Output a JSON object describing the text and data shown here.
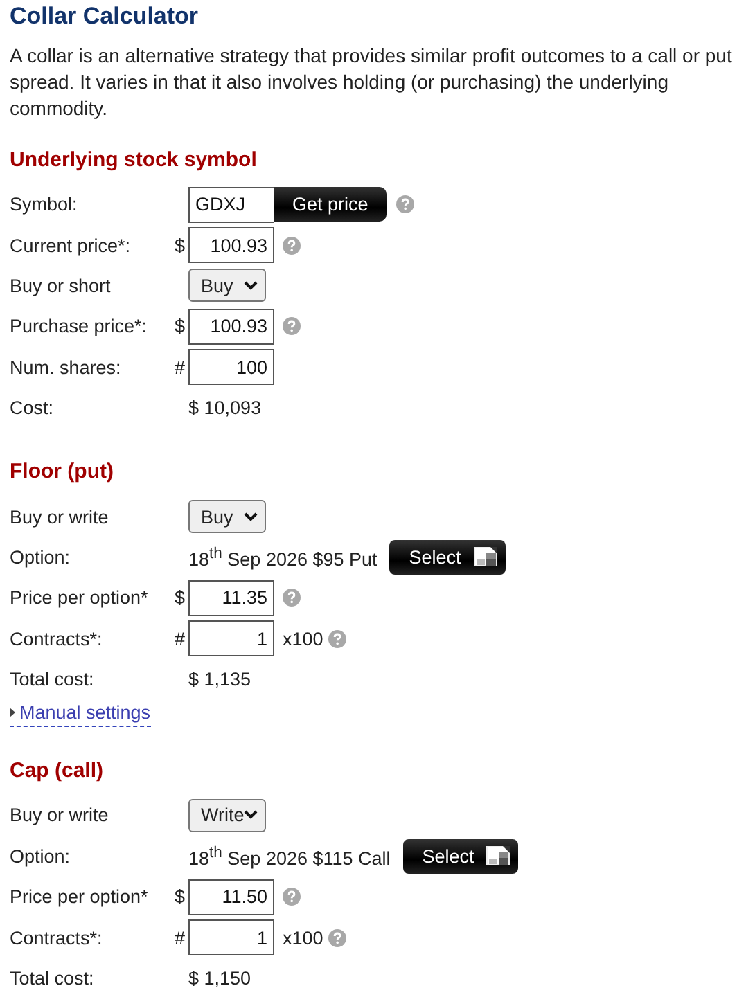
{
  "title": "Collar Calculator",
  "intro": "A collar is an alternative strategy that provides similar profit outcomes to a call or put spread. It varies in that it also involves holding (or purchasing) the underlying commodity.",
  "sections": [
    {
      "heading": "Underlying stock symbol",
      "rows": [
        {
          "kind": "symbol",
          "label": "Symbol:",
          "value": "GDXJ",
          "button": "Get price",
          "help": true
        },
        {
          "kind": "input",
          "label": "Current price*:",
          "prefix": "$",
          "value": "100.93",
          "help": true
        },
        {
          "kind": "select",
          "label": "Buy or short",
          "value": "Buy"
        },
        {
          "kind": "input",
          "label": "Purchase price*:",
          "prefix": "$",
          "value": "100.93",
          "help": true
        },
        {
          "kind": "input",
          "label": "Num. shares:",
          "prefix": "#",
          "value": "100",
          "help": false
        },
        {
          "kind": "text",
          "label": "Cost:",
          "value": "$ 10,093"
        }
      ]
    },
    {
      "heading": "Floor (put)",
      "rows": [
        {
          "kind": "select",
          "label": "Buy or write",
          "value": "Buy"
        },
        {
          "kind": "option",
          "label": "Option:",
          "value": "18$^{th}$ Sep 2026 $95 Put",
          "button": "Select"
        },
        {
          "kind": "input",
          "label": "Price per option*",
          "prefix": "$",
          "value": "11.35",
          "help": true
        },
        {
          "kind": "input",
          "label": "Contracts*:",
          "prefix": "#",
          "value": "1",
          "suffix": "x100",
          "help": true
        },
        {
          "kind": "text",
          "label": "Total cost:",
          "value": "$ 1,135"
        }
      ],
      "expander": {
        "label": "Manual settings",
        "expanded": false
      }
    },
    {
      "heading": "Cap (call)",
      "rows": [
        {
          "kind": "select",
          "label": "Buy or write",
          "value": "Write"
        },
        {
          "kind": "option",
          "label": "Option:",
          "value": "18$^{th}$ Sep 2026 $115 Call",
          "button": "Select"
        },
        {
          "kind": "input",
          "label": "Price per option*",
          "prefix": "$",
          "value": "11.50",
          "help": true
        },
        {
          "kind": "input",
          "label": "Contracts*:",
          "prefix": "#",
          "value": "1",
          "suffix": "x100",
          "help": true
        },
        {
          "kind": "text",
          "label": "Total cost:",
          "value": "$ 1,150"
        }
      ]
    }
  ]
}
